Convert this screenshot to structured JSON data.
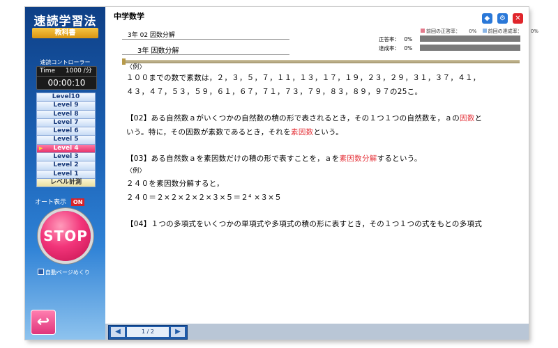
{
  "sidebar": {
    "title": "速読学習法",
    "subtitle": "教科書",
    "controller_label": "速読コントローラー",
    "speed_label": "Time",
    "speed_value": "1000 /分",
    "timer": "00:00:10",
    "levels": [
      "Level10",
      "Level 9",
      "Level 8",
      "Level 7",
      "Level 6",
      "Level 5",
      "Level 4",
      "Level 3",
      "Level 2",
      "Level 1"
    ],
    "active_level": "Level 4",
    "level_measure": "レベル計測",
    "auto_display_label": "オート表示",
    "auto_display_state": "ON",
    "stop_label": "STOP",
    "auto_page_label": "自動ページめくり",
    "back_icon": "return-arrow-icon"
  },
  "header": {
    "subject": "中学数学",
    "buttons": [
      "cube-icon",
      "gear-icon",
      "close-icon"
    ],
    "breadcrumb": "3年 02 因数分解",
    "chapter": "3年  因数分解",
    "legend_correct": "前回の正答率：",
    "legend_correct_value": "0%",
    "legend_achieve": "前回の達成率：",
    "legend_achieve_value": "0%",
    "correct_label": "正答率：",
    "correct_value": "0%",
    "achieve_label": "達成率：",
    "achieve_value": "0%"
  },
  "content": {
    "p0": "〈例〉",
    "p1": "１００までの数で素数は，２，３，５，７，１１，１３，１７，１９，２３，２９，３１，３７，４１，",
    "p2": "４３，４７，５３，５９，６１，６７，７１，７３，７９，８３，８９，９７の25こ。",
    "p3a": "【02】ある自然数ａがいくつかの自然数の積の形で表されるとき，その１つ１つの自然数を，ａの",
    "p3b": "因数",
    "p3c": "と",
    "p4a": "いう。特に，その因数が素数であるとき，それを",
    "p4b": "素因数",
    "p4c": "という。",
    "p5a": "【03】ある自然数ａを素因数だけの積の形で表すことを，ａを",
    "p5b": "素因数分解",
    "p5c": "するという。",
    "p6": "〈例〉",
    "p7": "２４０を素因数分解すると，",
    "p8": "２４０＝２×２×２×２×３×５＝２⁴ ×３×５",
    "p9": "【04】１つの多項式をいくつかの単項式や多項式の積の形に表すとき，その１つ１つの式をもとの多項式"
  },
  "pager": {
    "prev_icon": "prev-arrow-icon",
    "next_icon": "next-arrow-icon",
    "page": "1 / 2"
  },
  "colors": {
    "accent_pink": "#e6336a",
    "sidebar_blue": "#1c64b8",
    "highlight_red": "#e5333a"
  }
}
